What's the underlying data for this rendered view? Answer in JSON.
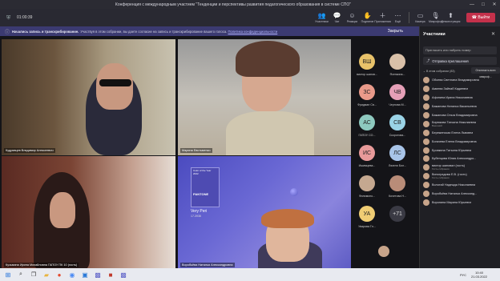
{
  "window": {
    "title": "Конференция с международным участием \"Тенденции и перспективы развития педагогического образования в системе СПО\"",
    "min": "—",
    "max": "□",
    "close": "✕"
  },
  "toolbar": {
    "timer": "01:00:39",
    "tools": [
      {
        "label": "Участники",
        "icon": "people-icon",
        "glyph": "👥"
      },
      {
        "label": "Чат",
        "icon": "chat-icon",
        "glyph": "💬"
      },
      {
        "label": "Реакции",
        "icon": "reactions-icon",
        "glyph": "☺"
      },
      {
        "label": "Поднятие",
        "icon": "raise-hand-icon",
        "glyph": "✋"
      },
      {
        "label": "Приложения",
        "icon": "apps-icon",
        "glyph": "＋"
      },
      {
        "label": "Ещё",
        "icon": "more-icon",
        "glyph": "⋯"
      }
    ],
    "devices": [
      {
        "label": "Камера",
        "icon": "camera-icon",
        "glyph": "▭"
      },
      {
        "label": "Микрофон",
        "icon": "microphone-icon",
        "glyph": "🎙"
      },
      {
        "label": "Демонстрация",
        "icon": "share-screen-icon",
        "glyph": "⬆"
      }
    ],
    "leave_label": "Выйти"
  },
  "banner": {
    "title": "Начались запись и транскрибирование.",
    "text": "Участвуя в этом собрании, вы даете согласие на запись и транскрибирование вашего голоса.",
    "link": "Политика конфиденциальности",
    "close": "Закрыть"
  },
  "tiles": [
    {
      "name": "Кудрявцев Владимир Алексеевич"
    },
    {
      "name": "Марина Евстьменко"
    },
    {
      "name": "Кузьмина Ирина Михайловна ГАПОУ ПК 10 (гость)"
    },
    {
      "name": "Воробьёва Наталья Александровна"
    }
  ],
  "pantone": {
    "line1": "Color of the Year",
    "line2": "2022",
    "brand": "PANTONE",
    "name": "Very Peri",
    "code": "17-3938"
  },
  "avatars": [
    {
      "initials": "ВШ",
      "name": "виктор шапов...",
      "color": "#e8c26a"
    },
    {
      "initials": "",
      "name": "Ясенкина...",
      "color": "#d9c0a8"
    },
    {
      "initials": "ЗС",
      "name": "Фридман Св...",
      "color": "#e99a8a"
    },
    {
      "initials": "ЧВ",
      "name": "Чернова М...",
      "color": "#e59fb7"
    },
    {
      "initials": "АС",
      "name": "ГАПОУ СО...",
      "color": "#8ec9bf"
    },
    {
      "initials": "СВ",
      "name": "Скоротова...",
      "color": "#9ad3e6"
    },
    {
      "initials": "ИС",
      "name": "Ишимцева...",
      "color": "#e89a9a"
    },
    {
      "initials": "ЛС",
      "name": "Лякеля Бол...",
      "color": "#a8c4e8"
    },
    {
      "initials": "",
      "name": "Филимоно...",
      "color": "#c5a890"
    },
    {
      "initials": "",
      "name": "Кочетова Н...",
      "color": "#b98c78"
    },
    {
      "initials": "УА",
      "name": "Уварова Гл...",
      "color": "#f0cd74"
    },
    {
      "initials": "+71",
      "name": "",
      "color": "#3a3a44"
    }
  ],
  "panel": {
    "title": "Участники",
    "invite_placeholder": "Пригласить или набрать номер",
    "share_label": "Отправка приглашения",
    "in_meeting": "В этом собрании (83)",
    "mute_all": "Отключить всех микроф...",
    "people": [
      {
        "name": "Обоева Светлана Владимировна",
        "meta": ""
      },
      {
        "name": "Амиева Зайнаб Кадиевна",
        "meta": ""
      },
      {
        "name": "Афонина Ирина Николаевна",
        "meta": ""
      },
      {
        "name": "Бажанова Наталья Васильевна",
        "meta": ""
      },
      {
        "name": "Бажанова Ольга Владимировна",
        "meta": ""
      },
      {
        "name": "Бирюкова Татьяна Николаевна",
        "meta": "Внешний"
      },
      {
        "name": "Береженская Елена Львовна",
        "meta": ""
      },
      {
        "name": "Богачева Елена Владимировна",
        "meta": ""
      },
      {
        "name": "Бровкина Татьяна Юрьевна",
        "meta": ""
      },
      {
        "name": "Бубенцова Юлия Александро...",
        "meta": ""
      },
      {
        "name": "виктор шаповал (гость)",
        "meta": "Гость собрания"
      },
      {
        "name": "Виноградова Е.В. (гость)",
        "meta": "Гость собрания"
      },
      {
        "name": "Волотай Надежда Николаевна",
        "meta": ""
      },
      {
        "name": "Воробьёва Наталья Александ...",
        "meta": ""
      },
      {
        "name": "Воронина Марина Юрьевна",
        "meta": ""
      }
    ]
  },
  "taskbar": {
    "time": "10:40",
    "date": "21.03.2022",
    "lang": "РУС"
  }
}
